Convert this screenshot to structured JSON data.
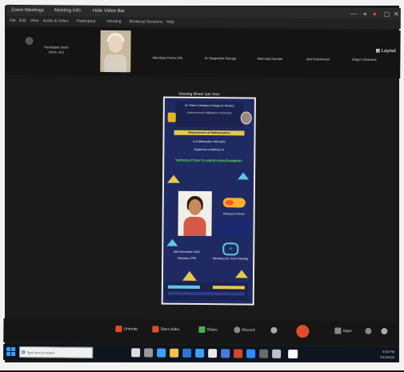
{
  "window": {
    "tabs": [
      "Zoom Meetings",
      "Meeting Info",
      "Hide Video Bar"
    ],
    "controls": [
      "minimize-icon",
      "maximize-icon",
      "close-icon"
    ]
  },
  "menu": {
    "items": [
      "File",
      "Edit",
      "View",
      "Audio & Video",
      "Participant",
      "Meeting",
      "Breakout Sessions",
      "Help"
    ]
  },
  "participants": {
    "names": [
      "Participant (host)",
      "Mandiyan Kumar (M)",
      "Dr Sangeetha Kavuga",
      "Manoranj Kandari",
      "Jyoti Sukumaran",
      "Binger Clearview"
    ],
    "host_subtitle": "(Host, me)"
  },
  "layout_button": "Layout",
  "share": {
    "label": "Viewing Bhavi Iyer Ana"
  },
  "poster": {
    "college": "St. Peter's Christian College for Women",
    "affiliation": "(Autonomous) Affiliated to University",
    "department": "Department of Mathematics",
    "organizes": "In Collaboration with IQAC",
    "event_type": "Organizes a Webinar on",
    "title": "\"INTRODUCTION TO LINEAR PROGRAMMING\"",
    "speaker_label": "Resource Person",
    "date": "05th December 2020",
    "time": "Saturday 4 PM",
    "platform": "Meeting Link: Zoom Meeting"
  },
  "toolbar": {
    "unmute": "Unmute",
    "start_video": "Start video",
    "share": "Share",
    "record": "Record",
    "apps": "Apps",
    "leave_color": "#e24b2b"
  },
  "taskbar": {
    "search_placeholder": "Type here to search",
    "time": "9:03 PM",
    "date": "5/12/2020",
    "accent": "#3ea0ff"
  }
}
